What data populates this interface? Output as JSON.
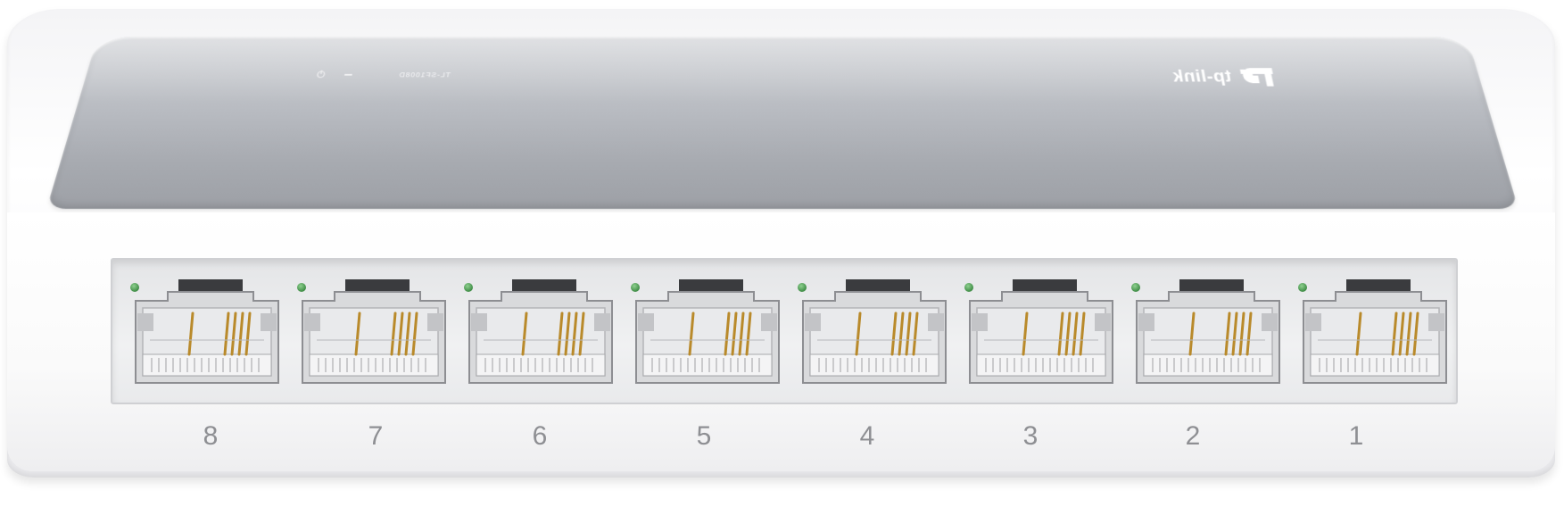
{
  "device": {
    "brand": "tp-link",
    "model": "TL-SF1008D",
    "icons": [
      "power-icon",
      "tp-link-logo-icon",
      "ethernet-port-icon"
    ],
    "colors": {
      "shell": "#ffffff",
      "top_panel": "#b8bbc1",
      "port_led": "#3f8d46",
      "contact_pins": "#b98a2b",
      "port_number": "#8e8f93"
    }
  },
  "ports": [
    {
      "number": "8"
    },
    {
      "number": "7"
    },
    {
      "number": "6"
    },
    {
      "number": "5"
    },
    {
      "number": "4"
    },
    {
      "number": "3"
    },
    {
      "number": "2"
    },
    {
      "number": "1"
    }
  ]
}
